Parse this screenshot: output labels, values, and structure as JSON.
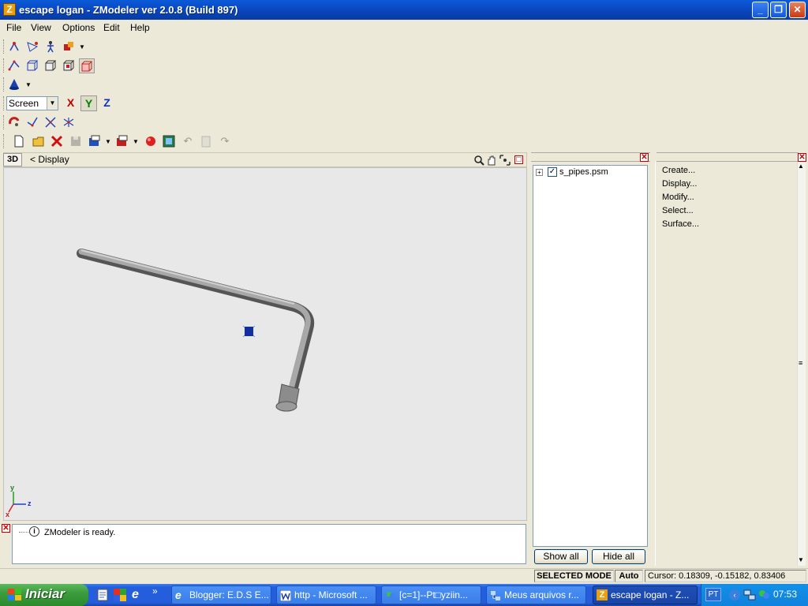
{
  "window": {
    "title": "escape logan - ZModeler ver 2.0.8 (Build 897)"
  },
  "menu": [
    "File",
    "View",
    "Options",
    "Edit",
    "Help"
  ],
  "toolbar": {
    "coord_system": "Screen",
    "axis_x": "X",
    "axis_y": "Y",
    "axis_z": "Z"
  },
  "viewport": {
    "mode_label": "3D",
    "name": "< Display",
    "axis_labels": {
      "y": "y",
      "z": "z",
      "x": "x"
    }
  },
  "log": {
    "message": "ZModeler is ready."
  },
  "scene_tree": {
    "root_item": "s_pipes.psm",
    "checked": true,
    "show_all_label": "Show all",
    "hide_all_label": "Hide all"
  },
  "command_panel": {
    "items": [
      "Create...",
      "Display...",
      "Modify...",
      "Select...",
      "Surface..."
    ]
  },
  "status": {
    "mode": "SELECTED MODE",
    "auto": "Auto",
    "cursor": "Cursor: 0.18309, -0.15182, 0.83406"
  },
  "taskbar": {
    "start_label": "Iniciar",
    "quick_launch": [
      "notepad-icon",
      "google-icon",
      "internet-explorer-icon"
    ],
    "tasks": [
      {
        "label": "Blogger: E.D.S E...",
        "icon": "internet-explorer-icon"
      },
      {
        "label": "http - Microsoft ...",
        "icon": "word-icon"
      },
      {
        "label": "[c=1]--Pt□yziin...",
        "icon": "messenger-icon"
      },
      {
        "label": "Meus arquivos r...",
        "icon": "network-icon"
      },
      {
        "label": "escape logan - Z...",
        "icon": "zmodeler-icon",
        "active": true
      }
    ],
    "language": "PT",
    "clock": "07:53"
  },
  "colors": {
    "titlebar": "#0b48c2",
    "taskbar": "#245edc",
    "viewport_bg": "#e8e8e8",
    "selection_marker": "#1030a0"
  }
}
